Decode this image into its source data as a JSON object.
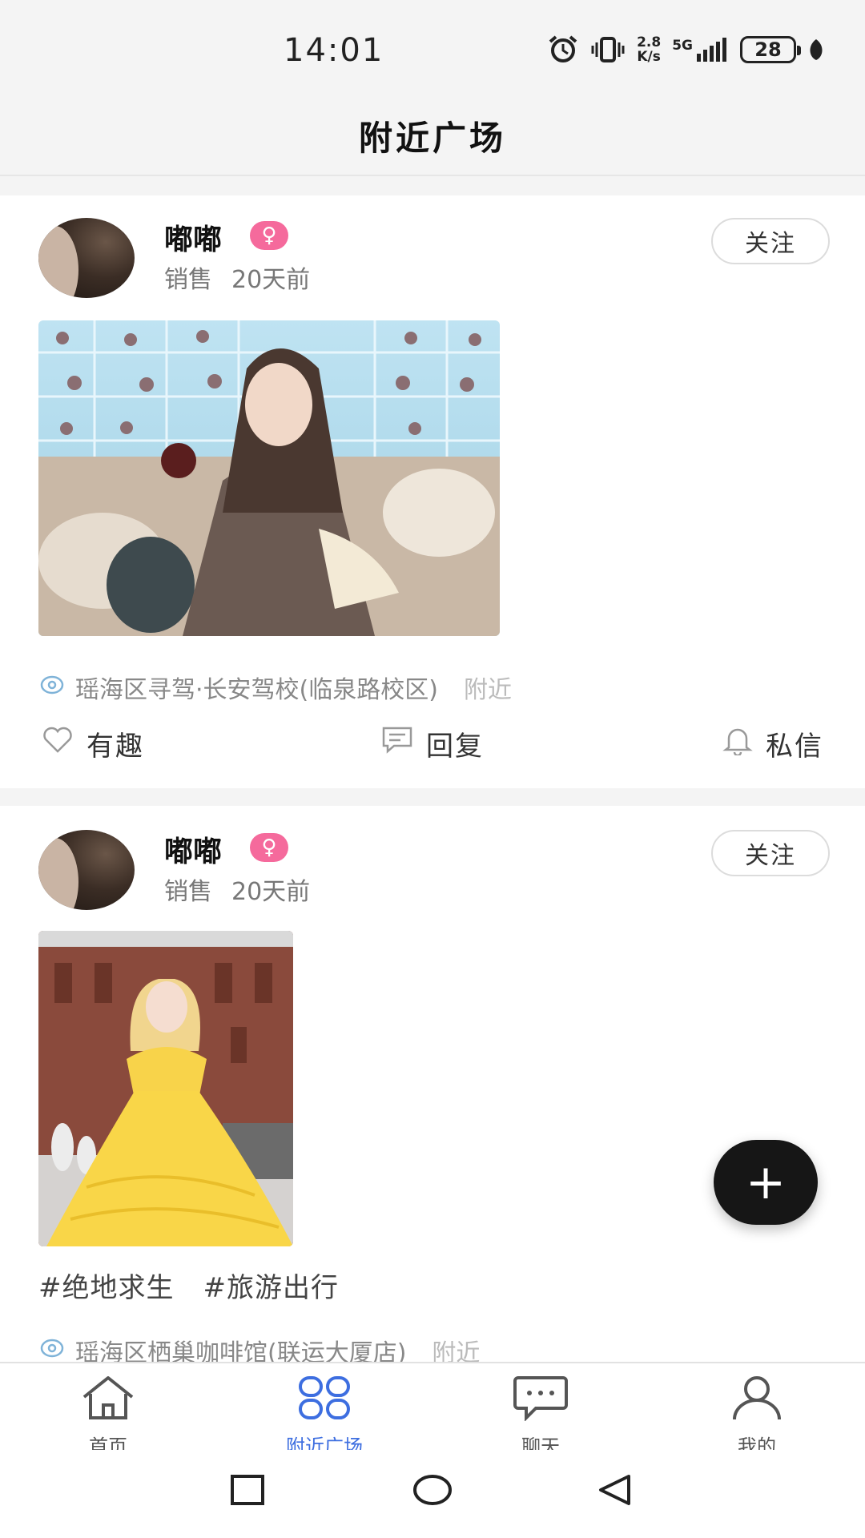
{
  "status_bar": {
    "time": "14:01",
    "net_speed_value": "2.8",
    "net_speed_unit": "K/s",
    "network": "5G",
    "battery": "28"
  },
  "header": {
    "title": "附近广场"
  },
  "posts": [
    {
      "username": "嘟嘟",
      "gender_symbol": "♀",
      "occupation": "销售",
      "time": "20天前",
      "follow_label": "关注",
      "location": "瑶海区寻驾·长安驾校(临泉路校区)",
      "near_label": "附近",
      "actions": {
        "like": "有趣",
        "reply": "回复",
        "message": "私信"
      }
    },
    {
      "username": "嘟嘟",
      "gender_symbol": "♀",
      "occupation": "销售",
      "time": "20天前",
      "follow_label": "关注",
      "tags": [
        "#绝地求生",
        "#旅游出行"
      ],
      "location": "瑶海区栖巢咖啡馆(联运大厦店)",
      "near_label": "附近"
    }
  ],
  "fab": {
    "label": "+"
  },
  "bottom_nav": {
    "items": [
      {
        "label": "首页",
        "icon": "home-icon"
      },
      {
        "label": "附近广场",
        "icon": "grid-icon",
        "active": true
      },
      {
        "label": "聊天",
        "icon": "chat-icon"
      },
      {
        "label": "我的",
        "icon": "user-icon"
      }
    ]
  },
  "colors": {
    "accent": "#3d6ee0",
    "gender_badge": "#f56a9c",
    "fab": "#161616"
  }
}
